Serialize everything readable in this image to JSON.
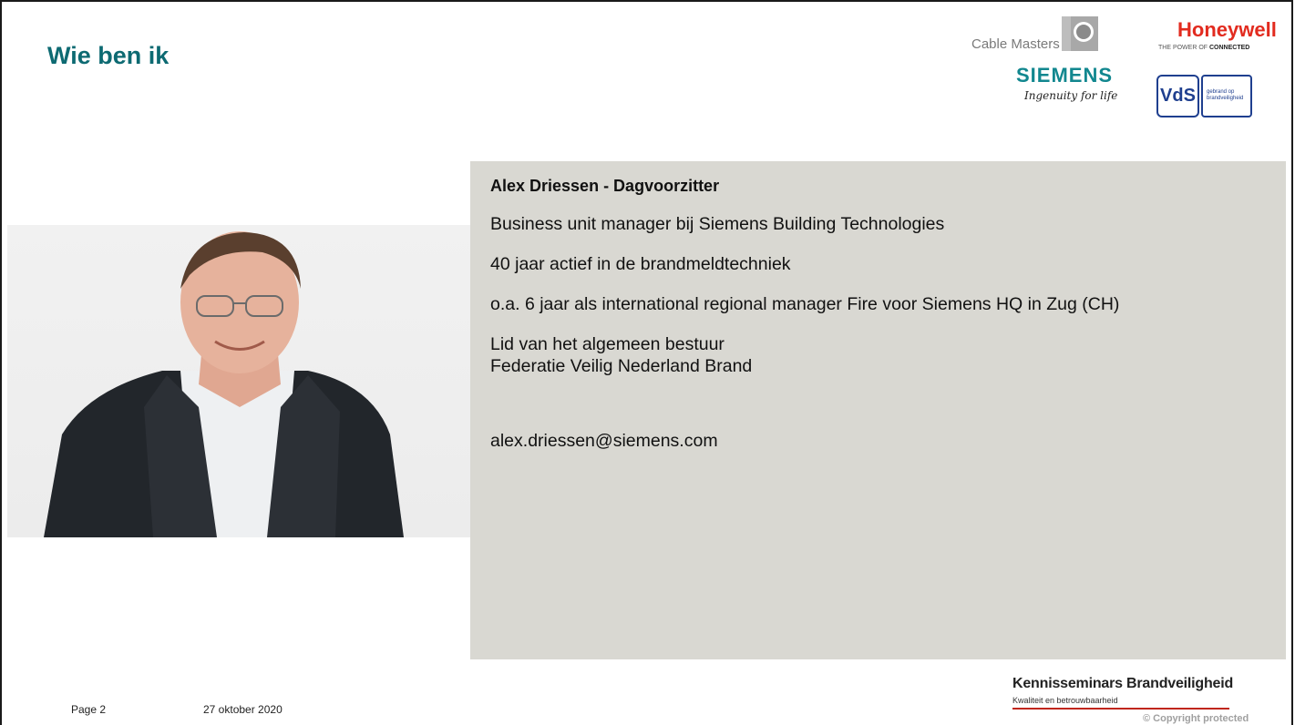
{
  "slide": {
    "title": "Wie ben ik"
  },
  "logos": {
    "cable_masters": "Cable Masters",
    "siemens": "SIEMENS",
    "siemens_tagline": "Ingenuity for life",
    "honeywell": "Honeywell",
    "honeywell_tagline_a": "THE POWER OF ",
    "honeywell_tagline_b": "CONNECTED",
    "vds": "VdS",
    "vds_sub": "gebrand op brandveiligheid"
  },
  "profile": {
    "name_role": "Alex Driessen - Dagvoorzitter",
    "lines": [
      "Business unit manager bij Siemens Building Technologies",
      "40 jaar actief in de brandmeldtechniek",
      "o.a. 6 jaar als international regional manager Fire voor Siemens HQ in Zug (CH)",
      "Lid van het algemeen bestuur",
      "Federatie Veilig Nederland Brand"
    ],
    "email": "alex.driessen@siemens.com"
  },
  "footer": {
    "page": "Page 2",
    "date": "27 oktober 2020",
    "brand_title": "Kennisseminars Brandveiligheid",
    "brand_sub": "Kwaliteit en betrouwbaarheid",
    "copyright": "© Copyright protected"
  },
  "colors": {
    "title": "#0d6a72",
    "panel": "#d9d8d2",
    "siemens": "#12878f",
    "honeywell": "#e22b1f",
    "vds": "#1f3f8f",
    "accent_line": "#c0261c"
  }
}
